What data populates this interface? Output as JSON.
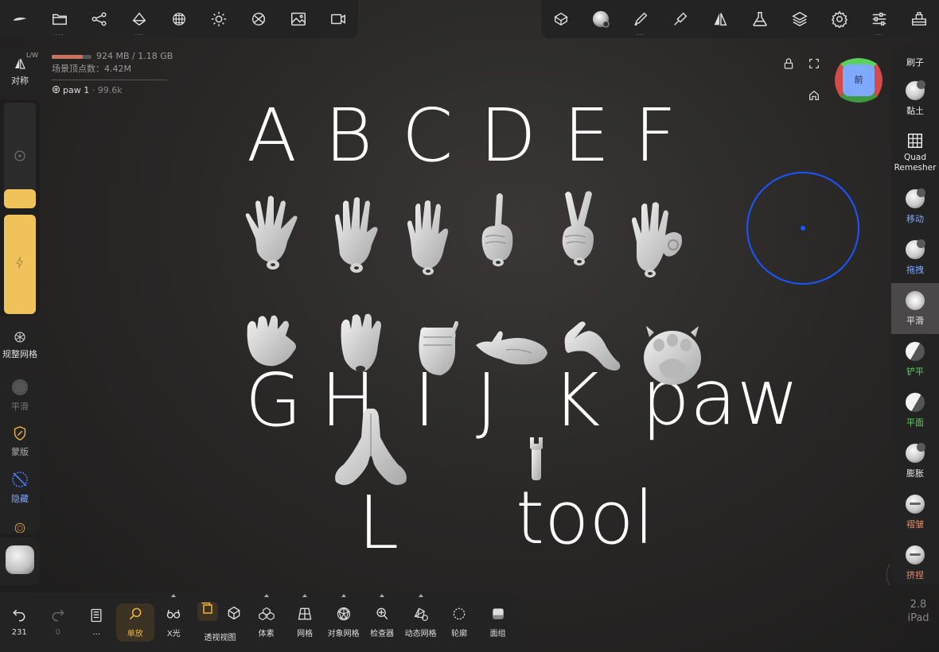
{
  "top_left_tools": [
    "logo-icon",
    "folder-icon",
    "scene-graph-icon",
    "layer-icon",
    "wireframe-sphere-icon",
    "light-icon",
    "material-ball-icon",
    "image-icon",
    "video-icon"
  ],
  "top_right_tools": [
    "camera-view-icon",
    "brush-material-icon",
    "pen-icon",
    "stroke-icon",
    "symmetry-icon",
    "flask-icon",
    "layers-icon",
    "settings-icon",
    "sliders-icon",
    "tool-bench-icon"
  ],
  "left_panel": {
    "symmetry_label": "对称",
    "lw_badge": "L/W",
    "remesh_label": "规整网格",
    "smooth_label": "平滑",
    "mask_label": "蒙版",
    "hide_label": "隐藏",
    "radius_fill": 0.78,
    "intensity_fill": 0.9
  },
  "stats": {
    "memory": "924 MB / 1.18 GB",
    "memory_fraction": 0.78,
    "vertex_label": "场景顶点数：4.42M",
    "object_name": "paw 1",
    "object_count": "· 99.6k"
  },
  "gizmo": {
    "face_label": "前"
  },
  "colors": {
    "accent": "#f0c35a",
    "active": "#f0b340",
    "cursor": "#1a56ff",
    "green": "#5ad15a",
    "blue": "#7fa8ff",
    "orange": "#e8896a"
  },
  "scene": {
    "row1": [
      "A",
      "B",
      "C",
      "D",
      "E",
      "F"
    ],
    "row2": [
      "G",
      "H",
      "I",
      "J",
      "K",
      "paw"
    ],
    "bottom": [
      "L",
      "tool"
    ]
  },
  "right_panel": [
    {
      "label": "刷子",
      "color": "#e8e8e8",
      "icon": "brush-ball-icon"
    },
    {
      "label": "黏土",
      "color": "#e8e8e8",
      "icon": "clay-ball-icon"
    },
    {
      "label": "Quad Remesher",
      "color": "#e8e8e8",
      "icon": "grid-icon"
    },
    {
      "label": "移动",
      "color": "#7fa8ff",
      "icon": "move-ball-icon"
    },
    {
      "label": "拖拽",
      "color": "#7fa8ff",
      "icon": "drag-ball-icon"
    },
    {
      "label": "平滑",
      "color": "#e8e8e8",
      "icon": "smooth-ball-icon"
    },
    {
      "label": "铲平",
      "color": "#5ad15a",
      "icon": "flatten-ball-icon"
    },
    {
      "label": "平面",
      "color": "#5ad15a",
      "icon": "plane-ball-icon"
    },
    {
      "label": "膨胀",
      "color": "#e8e8e8",
      "icon": "inflate-ball-icon"
    },
    {
      "label": "褶皱",
      "color": "#e8896a",
      "icon": "crease-ball-icon"
    },
    {
      "label": "挤捏",
      "color": "#e8896a",
      "icon": "pinch-ball-icon"
    }
  ],
  "bottom_bar": [
    {
      "label": "231",
      "icon": "undo-icon"
    },
    {
      "label": "0",
      "icon": "redo-icon"
    },
    {
      "label": "...",
      "icon": "notebook-icon"
    },
    {
      "label": "单放",
      "icon": "search-icon",
      "active": true
    },
    {
      "label": "X光",
      "icon": "glasses-icon"
    },
    {
      "label": "透视视图",
      "icon": "perspective-icon"
    },
    {
      "label": "体素",
      "icon": "voxel-icon"
    },
    {
      "label": "网格",
      "icon": "mesh-icon"
    },
    {
      "label": "对象网格",
      "icon": "object-mesh-icon"
    },
    {
      "label": "检查器",
      "icon": "inspector-icon"
    },
    {
      "label": "动态网格",
      "icon": "dynamic-mesh-icon"
    },
    {
      "label": "轮廓",
      "icon": "outline-icon"
    },
    {
      "label": "面组",
      "icon": "facegroup-icon"
    }
  ],
  "version": {
    "number": "2.8",
    "device": "iPad"
  }
}
